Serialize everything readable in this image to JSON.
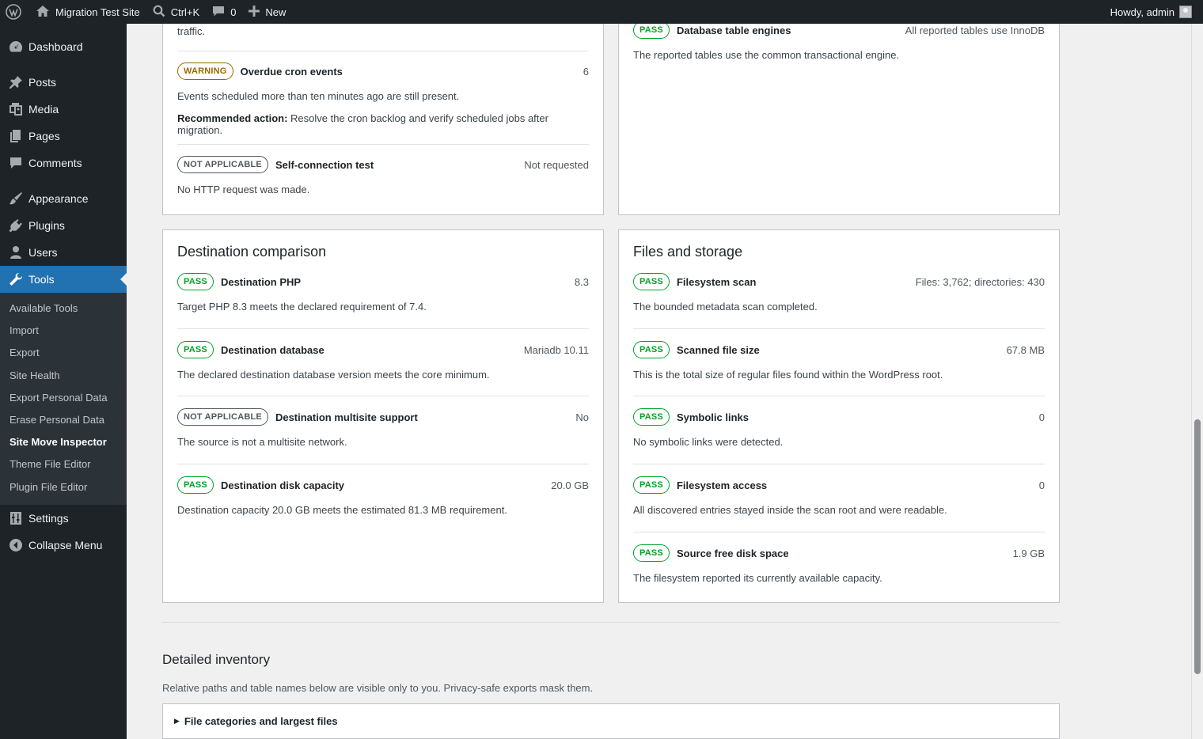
{
  "adminbar": {
    "site_name": "Migration Test Site",
    "search_shortcut": "Ctrl+K",
    "comments_count": "0",
    "new_label": "New",
    "greeting": "Howdy, admin"
  },
  "sidebar": {
    "items": [
      {
        "label": "Dashboard",
        "icon": "dashboard-icon"
      },
      {
        "label": "Posts",
        "icon": "pin-icon"
      },
      {
        "label": "Media",
        "icon": "media-icon"
      },
      {
        "label": "Pages",
        "icon": "pages-icon"
      },
      {
        "label": "Comments",
        "icon": "comments-icon"
      },
      {
        "label": "Appearance",
        "icon": "paintbrush-icon"
      },
      {
        "label": "Plugins",
        "icon": "plug-icon"
      },
      {
        "label": "Users",
        "icon": "users-icon"
      },
      {
        "label": "Tools",
        "icon": "wrench-icon"
      },
      {
        "label": "Settings",
        "icon": "settings-icon"
      },
      {
        "label": "Collapse Menu",
        "icon": "collapse-icon"
      }
    ],
    "tools_submenu": [
      "Available Tools",
      "Import",
      "Export",
      "Site Health",
      "Export Personal Data",
      "Erase Personal Data",
      "Site Move Inspector",
      "Theme File Editor",
      "Plugin File Editor"
    ]
  },
  "top_left_card": {
    "trailing_text": "traffic.",
    "checks": [
      {
        "status": "WARNING",
        "title": "Overdue cron events",
        "value": "6",
        "description": "Events scheduled more than ten minutes ago are still present.",
        "action_label": "Recommended action:",
        "action_text": "Resolve the cron backlog and verify scheduled jobs after migration."
      },
      {
        "status": "NOT APPLICABLE",
        "title": "Self-connection test",
        "value": "Not requested",
        "description": "No HTTP request was made."
      }
    ]
  },
  "top_right_card": {
    "checks": [
      {
        "status": "PASS",
        "title": "Database table engines",
        "value": "All reported tables use InnoDB",
        "description": "The reported tables use the common transactional engine."
      }
    ]
  },
  "destination_card": {
    "title": "Destination comparison",
    "checks": [
      {
        "status": "PASS",
        "title": "Destination PHP",
        "value": "8.3",
        "description": "Target PHP 8.3 meets the declared requirement of 7.4."
      },
      {
        "status": "PASS",
        "title": "Destination database",
        "value": "Mariadb 10.11",
        "description": "The declared destination database version meets the core minimum."
      },
      {
        "status": "NOT APPLICABLE",
        "title": "Destination multisite support",
        "value": "No",
        "description": "The source is not a multisite network."
      },
      {
        "status": "PASS",
        "title": "Destination disk capacity",
        "value": "20.0 GB",
        "description": "Destination capacity 20.0 GB meets the estimated 81.3 MB requirement."
      }
    ]
  },
  "files_card": {
    "title": "Files and storage",
    "checks": [
      {
        "status": "PASS",
        "title": "Filesystem scan",
        "value": "Files: 3,762; directories: 430",
        "description": "The bounded metadata scan completed."
      },
      {
        "status": "PASS",
        "title": "Scanned file size",
        "value": "67.8 MB",
        "description": "This is the total size of regular files found within the WordPress root."
      },
      {
        "status": "PASS",
        "title": "Symbolic links",
        "value": "0",
        "description": "No symbolic links were detected."
      },
      {
        "status": "PASS",
        "title": "Filesystem access",
        "value": "0",
        "description": "All discovered entries stayed inside the scan root and were readable."
      },
      {
        "status": "PASS",
        "title": "Source free disk space",
        "value": "1.9 GB",
        "description": "The filesystem reported its currently available capacity."
      }
    ]
  },
  "inventory": {
    "title": "Detailed inventory",
    "description": "Relative paths and table names below are visible only to you. Privacy-safe exports mask them.",
    "details_label": "File categories and largest files"
  },
  "colors": {
    "pass": "#00a32a",
    "warning": "#996800",
    "not_applicable": "#50575e",
    "menu_current": "#2271b1",
    "adminbar": "#1d2327"
  }
}
